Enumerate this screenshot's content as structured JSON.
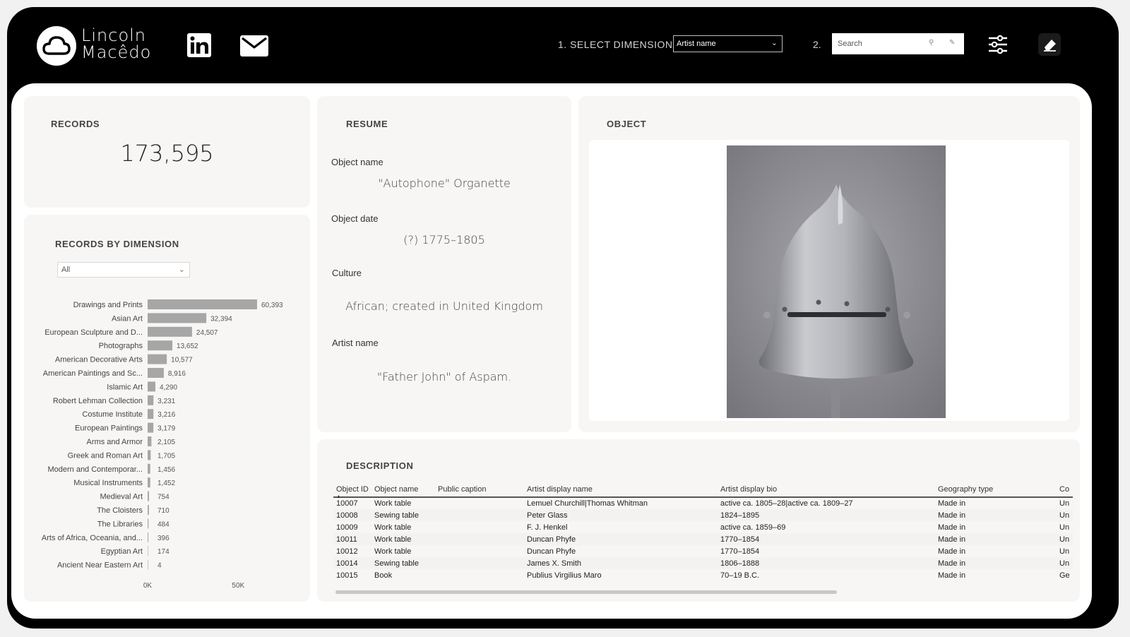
{
  "brand": {
    "line1": "Lincoln",
    "line2": "Macêdo"
  },
  "header": {
    "dimension_label": "1. SELECT DIMENSION:",
    "dimension_value": "Artist name",
    "step2_label": "2.",
    "search_placeholder": "Search"
  },
  "records": {
    "title": "RECORDS",
    "value": "173,595"
  },
  "records_by_dimension": {
    "title": "RECORDS BY DIMENSION",
    "filter_value": "All"
  },
  "chart_data": {
    "type": "bar",
    "orientation": "horizontal",
    "title": "RECORDS BY DIMENSION",
    "categories": [
      "Drawings and Prints",
      "Asian Art",
      "European Sculpture and D...",
      "Photographs",
      "American Decorative Arts",
      "American Paintings and Sc...",
      "Islamic Art",
      "Robert Lehman Collection",
      "Costume Institute",
      "European Paintings",
      "Arms and Armor",
      "Greek and Roman Art",
      "Modern and Contemporar...",
      "Musical Instruments",
      "Medieval Art",
      "The Cloisters",
      "The Libraries",
      "Arts of Africa, Oceania, and...",
      "Egyptian Art",
      "Ancient Near Eastern Art"
    ],
    "values": [
      60393,
      32394,
      24507,
      13652,
      10577,
      8916,
      4290,
      3231,
      3216,
      3179,
      2105,
      1705,
      1456,
      1452,
      754,
      710,
      484,
      396,
      174,
      4
    ],
    "value_labels": [
      "60,393",
      "32,394",
      "24,507",
      "13,652",
      "10,577",
      "8,916",
      "4,290",
      "3,231",
      "3,216",
      "3,179",
      "2,105",
      "1,705",
      "1,456",
      "1,452",
      "754",
      "710",
      "484",
      "396",
      "174",
      "4"
    ],
    "x_ticks": [
      {
        "value": 0,
        "label": "0K"
      },
      {
        "value": 50000,
        "label": "50K"
      }
    ],
    "xlim": [
      0,
      60393
    ],
    "bar_color": "#a6a6a6",
    "grid": false
  },
  "resume": {
    "title": "RESUME",
    "object_name_label": "Object name",
    "object_name": "\"Autophone\" Organette",
    "object_date_label": "Object date",
    "object_date": "(?) 1775–1805",
    "culture_label": "Culture",
    "culture": "African; created in United Kingdom",
    "artist_label": "Artist name",
    "artist": "\"Father John\" of Aspam."
  },
  "object_panel": {
    "title": "OBJECT"
  },
  "description": {
    "title": "DESCRIPTION",
    "columns": [
      "Object ID",
      "Object name",
      "Public caption",
      "Artist display name",
      "Artist display bio",
      "Geography type",
      "Co"
    ],
    "rows": [
      [
        "10007",
        "Work table",
        "",
        "Lemuel Churchill|Thomas Whitman",
        "active ca. 1805–28|active ca. 1809–27",
        "Made in",
        "Un"
      ],
      [
        "10008",
        "Sewing table",
        "",
        "Peter Glass",
        "1824–1895",
        "Made in",
        "Un"
      ],
      [
        "10009",
        "Work table",
        "",
        "F. J. Henkel",
        "active ca. 1859–69",
        "Made in",
        "Un"
      ],
      [
        "10011",
        "Work table",
        "",
        "Duncan Phyfe",
        "1770–1854",
        "Made in",
        "Un"
      ],
      [
        "10012",
        "Work table",
        "",
        "Duncan Phyfe",
        "1770–1854",
        "Made in",
        "Un"
      ],
      [
        "10014",
        "Sewing table",
        "",
        "James X. Smith",
        "1806–1888",
        "Made in",
        "Un"
      ],
      [
        "10015",
        "Book",
        "",
        "Publius Virgilius Maro",
        "70–19 B.C.",
        "Made in",
        "Ge"
      ]
    ]
  },
  "icons": {
    "logo": "cloud-icon",
    "linkedin": "linkedin-icon",
    "mail": "mail-icon",
    "search": "search-icon",
    "clear": "eraser-icon",
    "filters": "sliders-icon",
    "clear_all": "eraser-icon"
  }
}
